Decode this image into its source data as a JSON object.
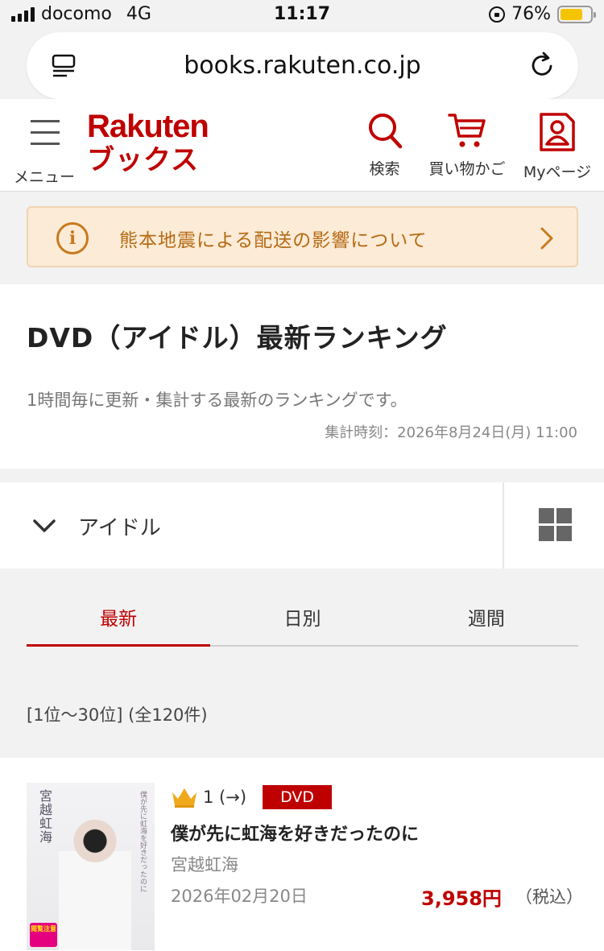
{
  "status_bar": {
    "carrier": "docomo",
    "network": "4G",
    "time": "11:17",
    "battery": "76%",
    "battery_level": 0.76
  },
  "browser": {
    "url": "books.rakuten.co.jp",
    "reader_icon": "reader-icon",
    "reload_icon": "reload-icon"
  },
  "header": {
    "menu_label": "メニュー",
    "logo_line1": "Rakuten",
    "logo_line2": "ブックス",
    "search_label": "検索",
    "cart_label": "買い物かご",
    "mypage_label": "Myページ",
    "brand_color": "#bf0000"
  },
  "notice": {
    "text": "熊本地震による配送の影響について",
    "icon": "info-icon",
    "color": "#b56a14"
  },
  "ranking": {
    "title": "DVD（アイドル）最新ランキング",
    "description": "1時間毎に更新・集計する最新のランキングです。",
    "aggregated_at": "集計時刻：2026年8月24日(月) 11:00"
  },
  "filter": {
    "category": "アイドル"
  },
  "tabs": [
    {
      "label": "最新",
      "active": true
    },
    {
      "label": "日別",
      "active": false
    },
    {
      "label": "週間",
      "active": false
    }
  ],
  "result_count": "[1位〜30位] (全120件)",
  "items": [
    {
      "rank": "1 (→)",
      "format_badge": "DVD",
      "title": "僕が先に虹海を好きだったのに",
      "artist": "宮越虹海",
      "release_date": "2026年02月20日",
      "price": "3,958円",
      "tax_note": "（税込）",
      "cover_text_main": "宮越虹海",
      "cover_text_sub": "僕が先に虹海を好きだったのに",
      "cover_stamp": "閲覧注意"
    }
  ]
}
